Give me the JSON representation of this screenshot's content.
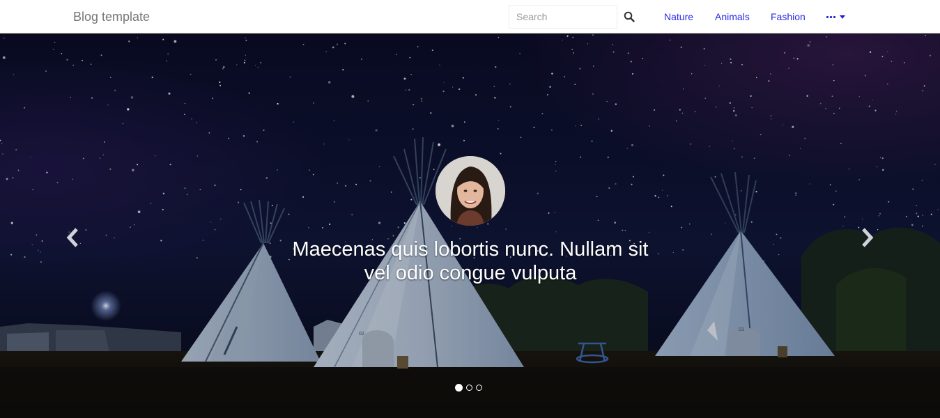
{
  "navbar": {
    "brand": "Blog template",
    "search_placeholder": "Search",
    "links": [
      "Nature",
      "Animals",
      "Fashion"
    ],
    "more_icon": "ellipsis-caret-down-icon"
  },
  "carousel": {
    "caption_line1": "Maecenas quis lobortis nunc. Nullam sit",
    "caption_line2": "vel odio congue vulputa",
    "active_slide": 1,
    "slide_count": 3,
    "prev_icon": "chevron-left-icon",
    "next_icon": "chevron-right-icon"
  },
  "colors": {
    "nav_link": "#2a2ae8",
    "brand": "#777777",
    "sky": "#0c0f2a"
  }
}
